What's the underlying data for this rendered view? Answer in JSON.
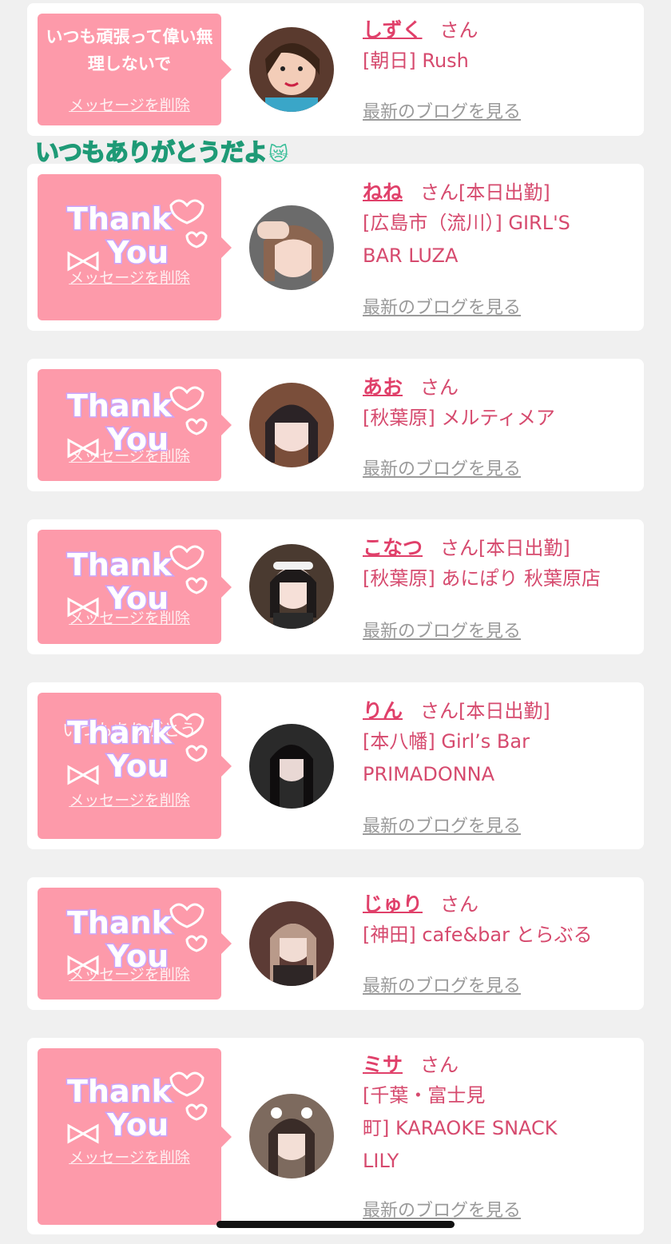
{
  "banner": {
    "text": "いつもありがとうだよ",
    "emoji": "😿"
  },
  "delete_label": "メッセージを削除",
  "blog_label": "最新のブログを見る",
  "san_label": "さん",
  "sticker_words": {
    "line1": "Thank",
    "line2": "You"
  },
  "colors": {
    "bubble": "#fd9aaa",
    "name": "#e0406a",
    "text": "#d64a6e",
    "blog": "#9a9a9a",
    "sticker_glow": "#c9a6ff",
    "banner": "#3cbf9a"
  },
  "entries": [
    {
      "message": "いつも頑張って偉い無理しないで",
      "name": "しずく",
      "status": "",
      "shop_lines": [
        "[朝日] Rush"
      ],
      "sticker": false
    },
    {
      "message": "",
      "name": "ねね",
      "status": "[本日出勤]",
      "shop_lines": [
        "[広島市（流川）] GIRL'S",
        "BAR LUZA"
      ],
      "sticker": true
    },
    {
      "message": "",
      "name": "あお",
      "status": "",
      "shop_lines": [
        "[秋葉原] メルティメア"
      ],
      "sticker": true
    },
    {
      "message": "",
      "name": "こなつ",
      "status": "[本日出勤]",
      "shop_lines": [
        "[秋葉原] あにぽり 秋葉原店"
      ],
      "sticker": true
    },
    {
      "message": "いつもありがとう",
      "name": "りん",
      "status": "[本日出勤]",
      "shop_lines": [
        "[本八幡] Girl’s Bar",
        "PRIMADONNA"
      ],
      "sticker": true
    },
    {
      "message": "",
      "name": "じゅり",
      "status": "",
      "shop_lines": [
        "[神田] cafe&bar とらぶる"
      ],
      "sticker": true
    },
    {
      "message": "",
      "name": "ミサ",
      "status": "",
      "shop_lines": [
        "[千葉・富士見",
        "町] KARAOKE SNACK",
        "LILY"
      ],
      "sticker": true
    }
  ]
}
